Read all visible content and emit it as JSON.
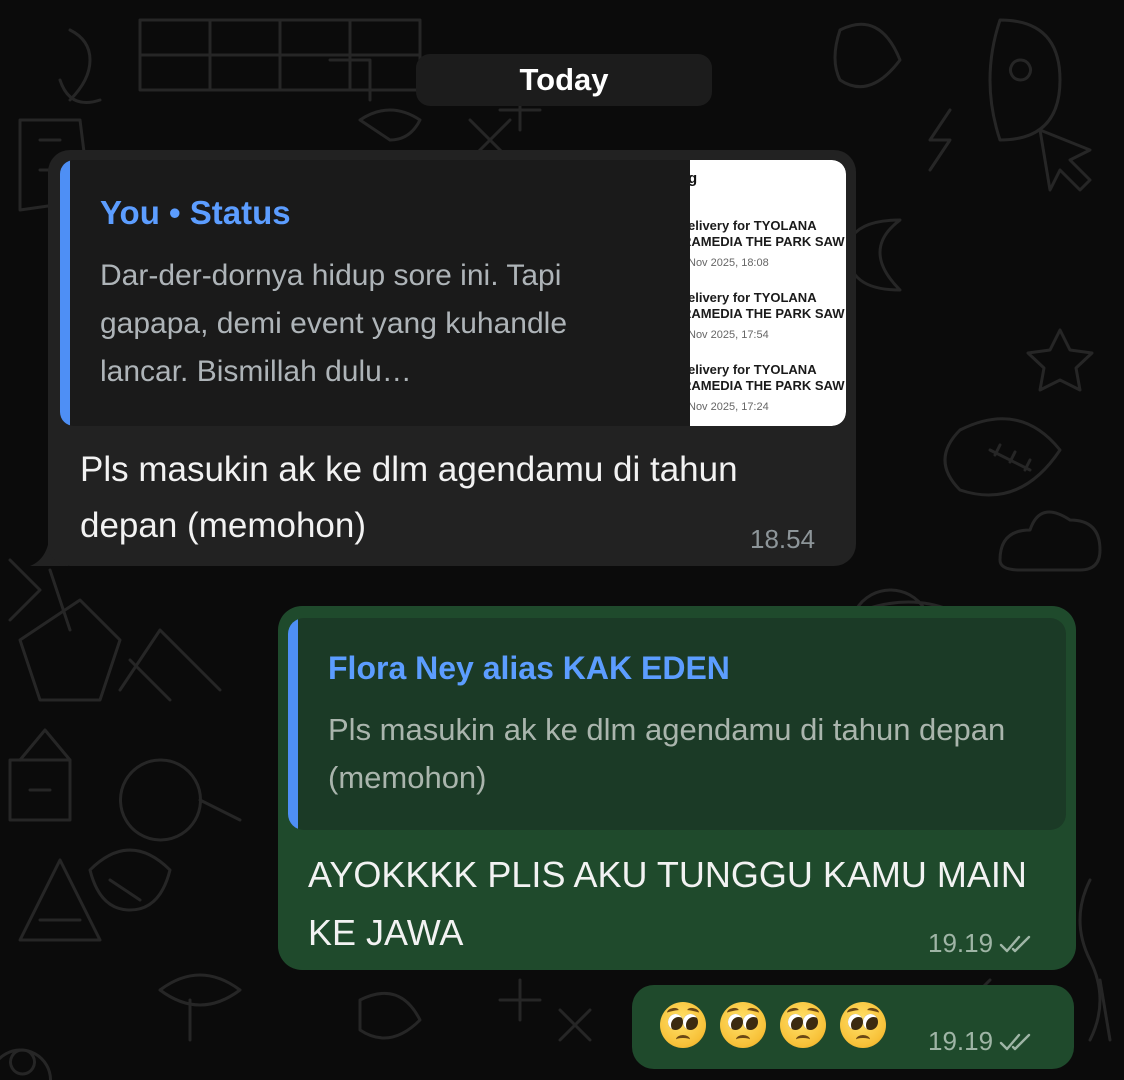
{
  "date_separator": "Today",
  "incoming_message": {
    "quote": {
      "author": "You • Status",
      "text": "Dar-der-dornya hidup sore ini. Tapi gapapa, demi event yang kuhandle lancar. Bismillah dulu…",
      "thumbnail": {
        "title": "g",
        "entries": [
          {
            "line1": "elivery for TYOLANA",
            "line2": "RAMEDIA THE PARK SAW",
            "date": "Nov 2025, 18:08"
          },
          {
            "line1": "elivery for TYOLANA",
            "line2": "RAMEDIA THE PARK SAW",
            "date": "Nov 2025, 17:54"
          },
          {
            "line1": "elivery for TYOLANA",
            "line2": "RAMEDIA THE PARK SAW",
            "date": "Nov 2025, 17:24"
          }
        ]
      }
    },
    "text": "Pls masukin ak ke dlm agendamu di tahun depan (memohon)",
    "time": "18.54"
  },
  "outgoing_message": {
    "quote": {
      "author": "Flora Ney alias KAK EDEN",
      "text": "Pls masukin ak ke dlm agendamu di tahun depan (memohon)"
    },
    "text": "AYOKKKK PLIS AKU TUNGGU KAMU MAIN KE JAWA",
    "time": "19.19",
    "status_icon": "double-check-icon"
  },
  "outgoing_emoji_message": {
    "emoji_icons": [
      "pleading-face-icon",
      "pleading-face-icon",
      "pleading-face-icon",
      "pleading-face-icon"
    ],
    "time": "19.19",
    "status_icon": "double-check-icon"
  },
  "colors": {
    "background": "#0b0b0b",
    "incoming_bubble": "#222222",
    "outgoing_bubble": "#1f4a2c",
    "quote_accent": "#4e8ff5",
    "quote_author": "#5c9dff"
  }
}
